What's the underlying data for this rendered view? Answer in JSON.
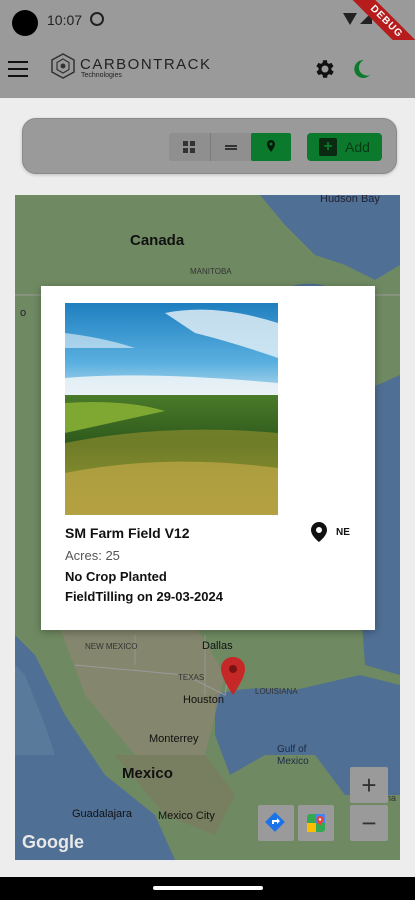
{
  "status_bar": {
    "time": "10:07",
    "debug_label": "DEBUG"
  },
  "app_bar": {
    "logo_title": "CARBONTRACK",
    "logo_subtitle": "Technologies",
    "menu_icon": "hamburger-menu-icon",
    "settings_icon": "gear-icon",
    "theme_icon": "moon-icon"
  },
  "toolbar": {
    "view_grid_icon": "grid-view-icon",
    "view_list_icon": "list-view-icon",
    "view_map_icon": "map-pin-icon",
    "active_view": "map",
    "add_label": "Add",
    "accent": "#0b7a2c"
  },
  "map": {
    "labels": {
      "hudson_bay": "Hudson Bay",
      "canada": "Canada",
      "manitoba": "MANITOBA",
      "ontario_partial": "o",
      "dallas": "Dallas",
      "texas": "TEXAS",
      "new_mexico": "NEW MEXICO",
      "houston": "Houston",
      "louisiana": "LOUISIANA",
      "gulf": "Gulf of",
      "gulf2": "Mexico",
      "monterrey": "Monterrey",
      "mexico": "Mexico",
      "guadalajara": "Guadalajara",
      "mexico_city": "Mexico City",
      "havana": "Havana",
      "google": "Google"
    },
    "zoom_in": "+",
    "zoom_out": "−",
    "marker_color": "#c62828"
  },
  "field_card": {
    "name": "SM Farm Field V12",
    "state": "NE",
    "acres": "Acres: 25",
    "crop": "No Crop Planted",
    "activity": "FieldTilling on 29-03-2024"
  }
}
